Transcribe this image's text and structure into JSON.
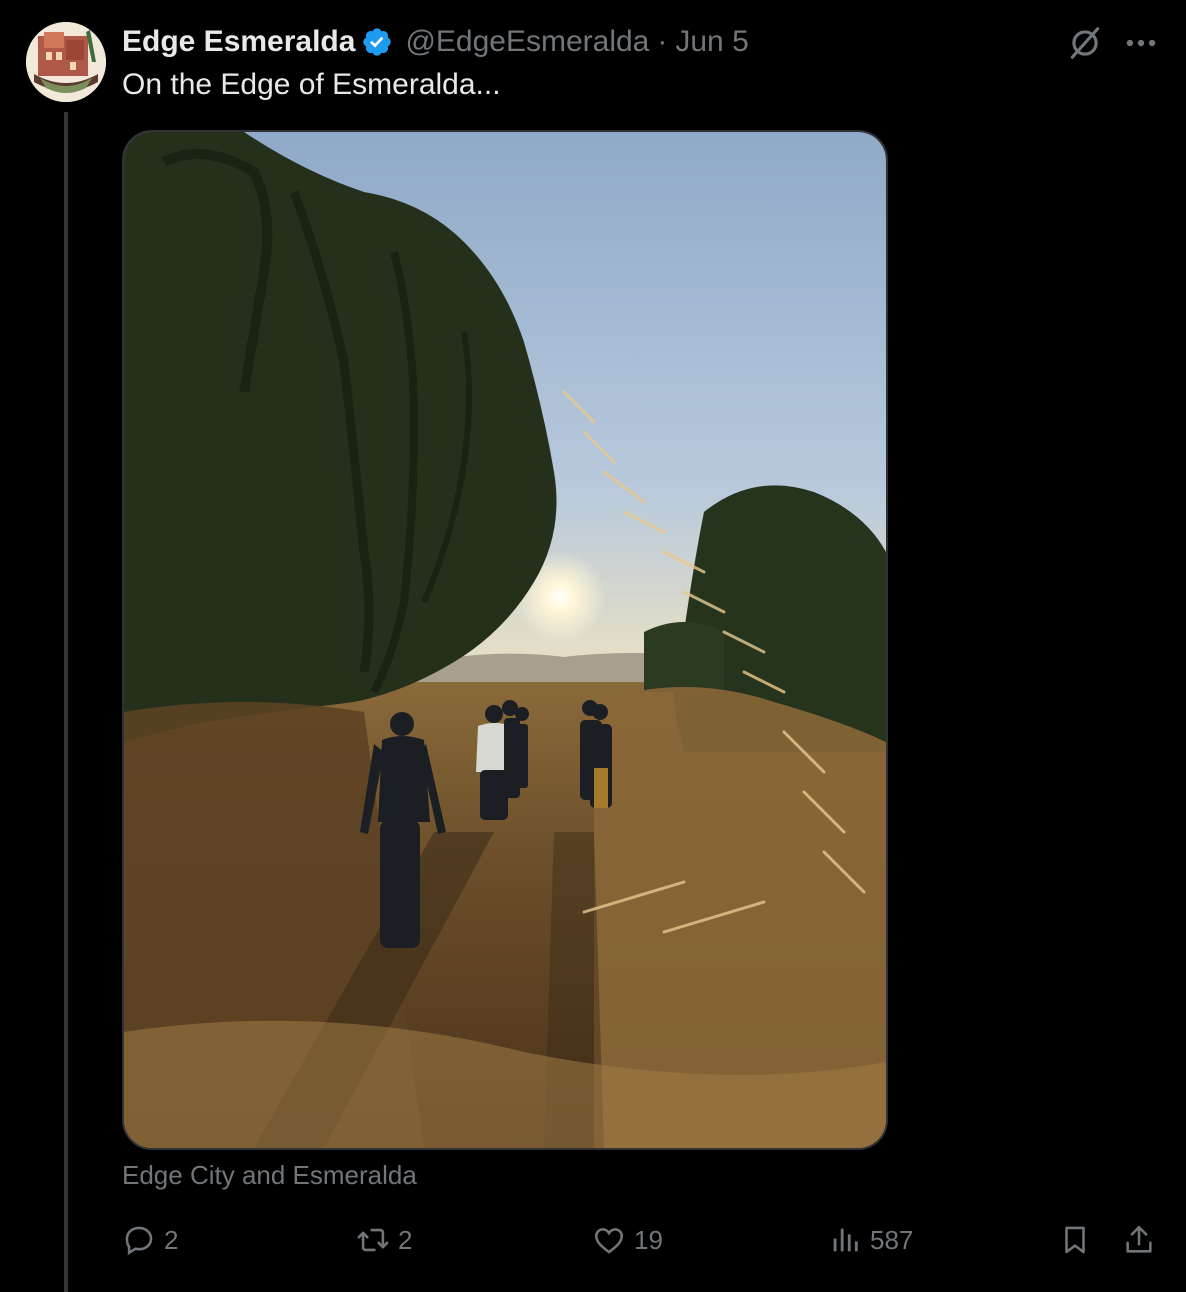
{
  "tweet": {
    "author": {
      "display_name": "Edge Esmeralda",
      "handle": "@EdgeEsmeralda",
      "verified": true
    },
    "separator": "·",
    "date": "Jun 5",
    "text": "On the Edge of Esmeralda...",
    "media_caption": "Edge City and Esmeralda"
  },
  "actions": {
    "replies": "2",
    "reposts": "2",
    "likes": "19",
    "views": "587"
  },
  "icons": {
    "verified": "verified-badge-icon",
    "grok": "grok-icon",
    "more": "more-icon",
    "reply": "reply-icon",
    "repost": "repost-icon",
    "like": "heart-icon",
    "views": "views-icon",
    "bookmark": "bookmark-icon",
    "share": "share-icon"
  },
  "colors": {
    "background": "#000000",
    "text_primary": "#e7e9ea",
    "text_secondary": "#71767b",
    "verified_blue": "#1d9bf0",
    "thread_line": "#333639"
  }
}
